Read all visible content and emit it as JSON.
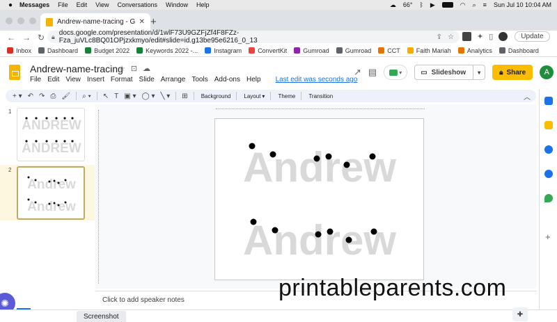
{
  "macbar": {
    "app": "Messages",
    "menus": [
      "File",
      "Edit",
      "View",
      "Conversations",
      "Window",
      "Help"
    ],
    "temp": "66°",
    "clock": "Sun Jul 10  10:04 AM"
  },
  "browser": {
    "tab_title": "Andrew-name-tracing - Google",
    "url": "docs.google.com/presentation/d/1wlF73U9GZFjZf4F8FZz-Fza_juVLc8BQ01OPjzxkmyo/edit#slide=id.g13be95e6216_0_13",
    "update_label": "Update"
  },
  "bookmarks": [
    {
      "label": "Inbox",
      "color": "#d93025"
    },
    {
      "label": "Dashboard",
      "color": "#5f6368"
    },
    {
      "label": "Budget 2022",
      "color": "#188038"
    },
    {
      "label": "Keywords 2022 -...",
      "color": "#188038"
    },
    {
      "label": "Instagram",
      "color": "#1a73e8"
    },
    {
      "label": "ConvertKit",
      "color": "#e8453c"
    },
    {
      "label": "Gumroad",
      "color": "#8e24aa"
    },
    {
      "label": "Gumroad",
      "color": "#5f6368"
    },
    {
      "label": "CCT",
      "color": "#e37400"
    },
    {
      "label": "Faith Mariah",
      "color": "#f9ab00"
    },
    {
      "label": "Analytics",
      "color": "#e37400"
    },
    {
      "label": "Dashboard",
      "color": "#5f6368"
    }
  ],
  "doc": {
    "title": "Andrew-name-tracing",
    "menus": [
      "File",
      "Edit",
      "View",
      "Insert",
      "Format",
      "Slide",
      "Arrange",
      "Tools",
      "Add-ons",
      "Help"
    ],
    "last_edit": "Last edit was seconds ago",
    "slideshow_label": "Slideshow",
    "share_label": "Share",
    "avatar_initial": "A"
  },
  "toolbar": {
    "background": "Background",
    "layout": "Layout",
    "theme": "Theme",
    "transition": "Transition"
  },
  "filmstrip": {
    "slide_numbers": [
      "1",
      "2"
    ],
    "thumb1_text": "ANDREW",
    "thumb2_text": "Andrew",
    "bottom_tab": "Screenshot"
  },
  "slide": {
    "word": "Andrew"
  },
  "notes": {
    "placeholder": "Click to add speaker notes"
  },
  "watermark": "printableparents.com",
  "colors": {
    "accent_yellow": "#fbbc04",
    "link_blue": "#1a73e8",
    "trace_gray": "#d9d9d9"
  }
}
